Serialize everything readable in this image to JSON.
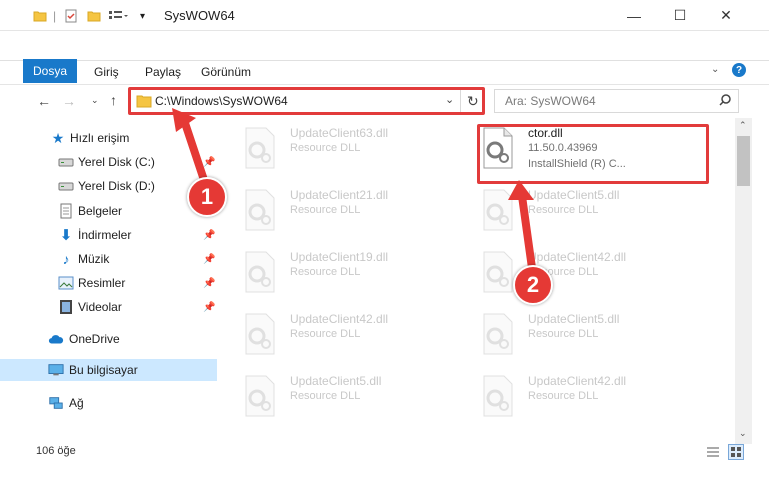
{
  "window": {
    "title": "SysWOW64",
    "minimize": "—",
    "maximize": "☐",
    "close": "✕"
  },
  "ribbon": {
    "tabs": [
      {
        "label": "Dosya"
      },
      {
        "label": "Giriş"
      },
      {
        "label": "Paylaş"
      },
      {
        "label": "Görünüm"
      }
    ]
  },
  "navigation": {
    "address": "C:\\Windows\\SysWOW64",
    "search_placeholder": "Ara: SysWOW64"
  },
  "sidebar": {
    "items": [
      {
        "label": "Hızlı erişim",
        "icon": "star-icon"
      },
      {
        "label": "Yerel Disk (C:)",
        "icon": "drive-icon",
        "pinned": true
      },
      {
        "label": "Yerel Disk (D:)",
        "icon": "drive-icon",
        "pinned": true
      },
      {
        "label": "Belgeler",
        "icon": "documents-icon",
        "pinned": true
      },
      {
        "label": "İndirmeler",
        "icon": "downloads-icon",
        "pinned": true
      },
      {
        "label": "Müzik",
        "icon": "music-icon",
        "pinned": true
      },
      {
        "label": "Resimler",
        "icon": "pictures-icon",
        "pinned": true
      },
      {
        "label": "Videolar",
        "icon": "videos-icon",
        "pinned": true
      },
      {
        "label": "OneDrive",
        "icon": "cloud-icon"
      },
      {
        "label": "Bu bilgisayar",
        "icon": "computer-icon",
        "selected": true
      },
      {
        "label": "Ağ",
        "icon": "network-icon"
      }
    ]
  },
  "files": [
    {
      "name": "UpdateClient63.dll",
      "desc": "Resource DLL"
    },
    {
      "name": "ctor.dll",
      "version": "11.50.0.43969",
      "desc": "InstallShield (R) C...",
      "active": true
    },
    {
      "name": "UpdateClient21.dll",
      "desc": "Resource DLL"
    },
    {
      "name": "UpdateClient5.dll",
      "desc": "Resource DLL"
    },
    {
      "name": "UpdateClient19.dll",
      "desc": "Resource DLL"
    },
    {
      "name": "UpdateClient42.dll",
      "desc": "Resource DLL"
    },
    {
      "name": "UpdateClient42.dll",
      "desc": "Resource DLL"
    },
    {
      "name": "UpdateClient5.dll",
      "desc": "Resource DLL"
    },
    {
      "name": "UpdateClient5.dll",
      "desc": "Resource DLL"
    },
    {
      "name": "UpdateClient42.dll",
      "desc": "Resource DLL"
    }
  ],
  "status": {
    "count": "106 öğe"
  },
  "annotations": {
    "badge1": "1",
    "badge2": "2"
  },
  "colors": {
    "accent": "#1979ca",
    "highlight": "#e23b3b",
    "selected": "#cce8ff"
  }
}
